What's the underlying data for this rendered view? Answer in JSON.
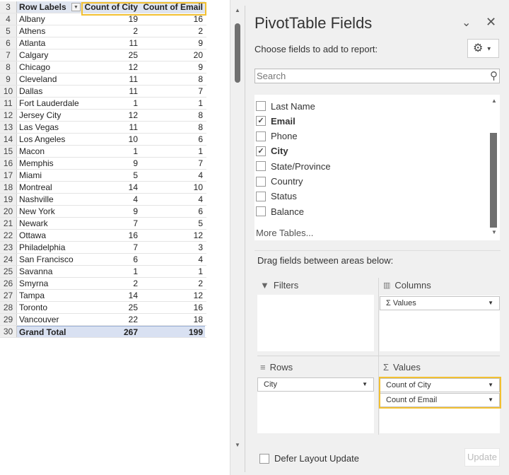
{
  "sheet": {
    "header": {
      "row": "3",
      "col_a": "Row Labels",
      "col_b": "Count of City",
      "col_c": "Count of Email"
    },
    "rows": [
      {
        "n": "4",
        "city": "Albany",
        "count_city": "19",
        "count_email": "16"
      },
      {
        "n": "5",
        "city": "Athens",
        "count_city": "2",
        "count_email": "2"
      },
      {
        "n": "6",
        "city": "Atlanta",
        "count_city": "11",
        "count_email": "9"
      },
      {
        "n": "7",
        "city": "Calgary",
        "count_city": "25",
        "count_email": "20"
      },
      {
        "n": "8",
        "city": "Chicago",
        "count_city": "12",
        "count_email": "9"
      },
      {
        "n": "9",
        "city": "Cleveland",
        "count_city": "11",
        "count_email": "8"
      },
      {
        "n": "10",
        "city": "Dallas",
        "count_city": "11",
        "count_email": "7"
      },
      {
        "n": "11",
        "city": "Fort Lauderdale",
        "count_city": "1",
        "count_email": "1"
      },
      {
        "n": "12",
        "city": "Jersey City",
        "count_city": "12",
        "count_email": "8"
      },
      {
        "n": "13",
        "city": "Las Vegas",
        "count_city": "11",
        "count_email": "8"
      },
      {
        "n": "14",
        "city": "Los Angeles",
        "count_city": "10",
        "count_email": "6"
      },
      {
        "n": "15",
        "city": "Macon",
        "count_city": "1",
        "count_email": "1"
      },
      {
        "n": "16",
        "city": "Memphis",
        "count_city": "9",
        "count_email": "7"
      },
      {
        "n": "17",
        "city": "Miami",
        "count_city": "5",
        "count_email": "4"
      },
      {
        "n": "18",
        "city": "Montreal",
        "count_city": "14",
        "count_email": "10"
      },
      {
        "n": "19",
        "city": "Nashville",
        "count_city": "4",
        "count_email": "4"
      },
      {
        "n": "20",
        "city": "New York",
        "count_city": "9",
        "count_email": "6"
      },
      {
        "n": "21",
        "city": "Newark",
        "count_city": "7",
        "count_email": "5"
      },
      {
        "n": "22",
        "city": "Ottawa",
        "count_city": "16",
        "count_email": "12"
      },
      {
        "n": "23",
        "city": "Philadelphia",
        "count_city": "7",
        "count_email": "3"
      },
      {
        "n": "24",
        "city": "San Francisco",
        "count_city": "6",
        "count_email": "4"
      },
      {
        "n": "25",
        "city": "Savanna",
        "count_city": "1",
        "count_email": "1"
      },
      {
        "n": "26",
        "city": "Smyrna",
        "count_city": "2",
        "count_email": "2"
      },
      {
        "n": "27",
        "city": "Tampa",
        "count_city": "14",
        "count_email": "12"
      },
      {
        "n": "28",
        "city": "Toronto",
        "count_city": "25",
        "count_email": "16"
      },
      {
        "n": "29",
        "city": "Vancouver",
        "count_city": "22",
        "count_email": "18"
      }
    ],
    "total": {
      "n": "30",
      "label": "Grand Total",
      "count_city": "267",
      "count_email": "199"
    }
  },
  "pane": {
    "title": "PivotTable Fields",
    "choose": "Choose fields to add to report:",
    "search_placeholder": "Search",
    "fields": [
      {
        "label": "Last Name",
        "checked": false
      },
      {
        "label": "Email",
        "checked": true
      },
      {
        "label": "Phone",
        "checked": false
      },
      {
        "label": "City",
        "checked": true
      },
      {
        "label": "State/Province",
        "checked": false
      },
      {
        "label": "Country",
        "checked": false
      },
      {
        "label": "Status",
        "checked": false
      },
      {
        "label": "Balance",
        "checked": false
      }
    ],
    "more_tables": "More Tables...",
    "drag_hint": "Drag fields between areas below:",
    "areas": {
      "filters": "Filters",
      "columns": "Columns",
      "columns_items": [
        "Values"
      ],
      "rows": "Rows",
      "rows_items": [
        "City"
      ],
      "values": "Values",
      "values_items": [
        "Count of City",
        "Count of Email"
      ]
    },
    "defer": "Defer Layout Update",
    "update": "Update",
    "highlight_color": "#f2c031"
  }
}
